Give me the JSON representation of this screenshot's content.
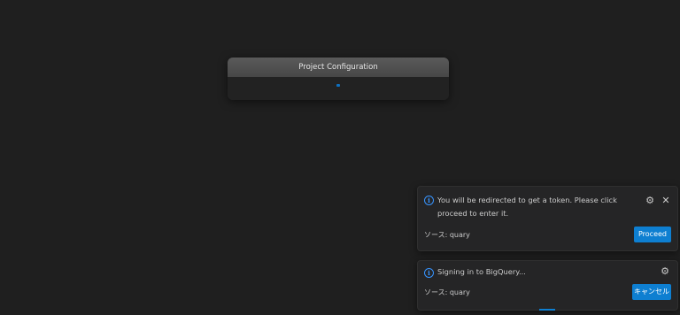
{
  "quick_input": {
    "title": "Project Configuration"
  },
  "notifications": [
    {
      "message": "You will be redirected to get a token. Please click proceed to enter it.",
      "source": "ソース: quary",
      "button_label": "Proceed",
      "icons": {
        "info": "info-icon",
        "gear": "gear-icon",
        "close": "close-icon"
      }
    },
    {
      "message": "Signing in to BigQuery...",
      "source": "ソース: quary",
      "button_label": "キャンセル",
      "icons": {
        "info": "info-icon",
        "gear": "gear-icon"
      }
    }
  ],
  "colors": {
    "background": "#1f1f1f",
    "accent": "#0e7fd1",
    "info": "#3794ff"
  }
}
